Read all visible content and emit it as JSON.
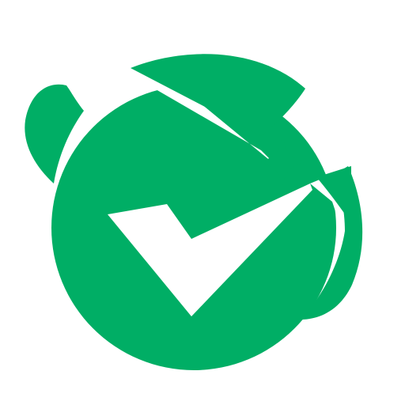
{
  "logo": {
    "icon": "planet-check-sparkle-logo",
    "colors": {
      "brand_green": "#00AE65",
      "background": "#FFFFFF"
    }
  }
}
